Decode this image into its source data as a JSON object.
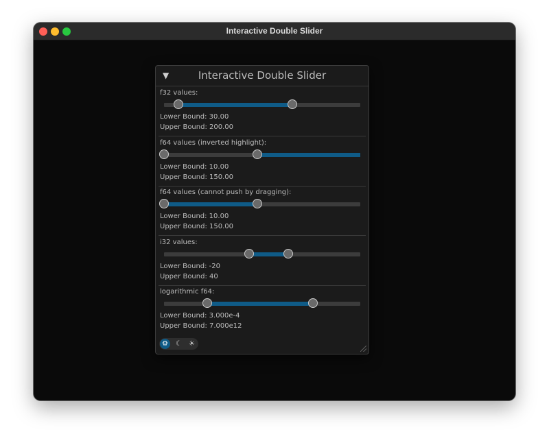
{
  "window": {
    "title": "Interactive Double Slider"
  },
  "panel": {
    "title": "Interactive Double Slider",
    "collapse_glyph": "▼",
    "sliders": [
      {
        "label": "f32 values:",
        "lower_text": "Lower Bound: 30.00",
        "upper_text": "Upper Bound: 200.00",
        "lower_pos": 0.075,
        "upper_pos": 0.655,
        "inverted": false
      },
      {
        "label": "f64 values (inverted highlight):",
        "lower_text": "Lower Bound: 10.00",
        "upper_text": "Upper Bound: 150.00",
        "lower_pos": 0.0,
        "upper_pos": 0.475,
        "inverted": true
      },
      {
        "label": "f64 values (cannot push by dragging):",
        "lower_text": "Lower Bound: 10.00",
        "upper_text": "Upper Bound: 150.00",
        "lower_pos": 0.0,
        "upper_pos": 0.475,
        "inverted": false
      },
      {
        "label": "i32 values:",
        "lower_text": "Lower Bound: -20",
        "upper_text": "Upper Bound: 40",
        "lower_pos": 0.435,
        "upper_pos": 0.633,
        "inverted": false
      },
      {
        "label": "logarithmic f64:",
        "lower_text": "Lower Bound: 3.000e-4",
        "upper_text": "Upper Bound: 7.000e12",
        "lower_pos": 0.22,
        "upper_pos": 0.757,
        "inverted": false
      }
    ],
    "theme_switch": {
      "options": [
        {
          "name": "settings-icon",
          "glyph": "⚙",
          "active": true
        },
        {
          "name": "moon-icon",
          "glyph": "☾",
          "active": false
        },
        {
          "name": "sun-icon",
          "glyph": "☀",
          "active": false
        }
      ]
    }
  },
  "colors": {
    "accent": "#0f5b87",
    "window_bg": "#0a0a0a",
    "panel_bg": "#1b1b1b"
  }
}
